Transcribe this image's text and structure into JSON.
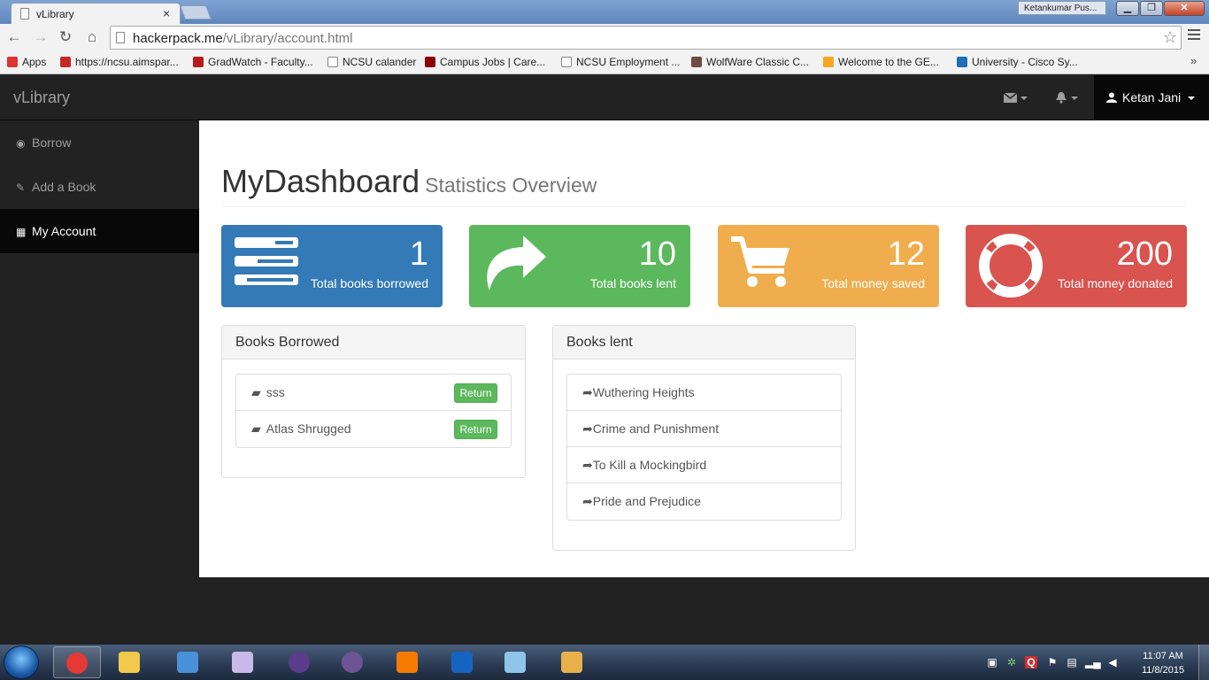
{
  "browser": {
    "tab_title": "vLibrary",
    "tab_close": "×",
    "profile_name": "Ketankumar Pus...",
    "window_buttons": {
      "minimize": "▁",
      "maximize": "❐",
      "close": "✕"
    },
    "url_host": "hackerpack.me",
    "url_path": "/vLibrary/account.html",
    "bookmarks": [
      {
        "label": "Apps",
        "color": "#d33"
      },
      {
        "label": "https://ncsu.aimspar...",
        "color": "#c62828"
      },
      {
        "label": "GradWatch - Faculty...",
        "color": "#b71c1c"
      },
      {
        "label": "NCSU calander",
        "color": "#ffffff"
      },
      {
        "label": "Campus Jobs | Care...",
        "color": "#8b0000"
      },
      {
        "label": "NCSU Employment ...",
        "color": "#ffffff"
      },
      {
        "label": "WolfWare Classic C...",
        "color": "#6d4c41"
      },
      {
        "label": "Welcome to the GE...",
        "color": "#f5a623"
      },
      {
        "label": "University - Cisco Sy...",
        "color": "#1e6fb5"
      }
    ],
    "bookmarks_more": "»"
  },
  "app": {
    "brand": "vLibrary",
    "user_name": "Ketan Jani",
    "sidebar": [
      {
        "label": "Borrow",
        "icon": "dashboard-icon",
        "glyph": "◉"
      },
      {
        "label": "Add a Book",
        "icon": "edit-icon",
        "glyph": "✎"
      },
      {
        "label": "My Account",
        "icon": "table-icon",
        "glyph": "▦"
      }
    ],
    "page_title": "MyDashboard",
    "page_subtitle": "Statistics Overview",
    "stats": [
      {
        "value": "1",
        "label": "Total books borrowed",
        "color": "#337ab7",
        "icon": "list-icon"
      },
      {
        "value": "10",
        "label": "Total books lent",
        "color": "#5cb85c",
        "icon": "share-arrow-icon"
      },
      {
        "value": "12",
        "label": "Total money saved",
        "color": "#f0ad4e",
        "icon": "cart-icon"
      },
      {
        "value": "200",
        "label": "Total money donated",
        "color": "#d9534f",
        "icon": "life-ring-icon"
      }
    ],
    "borrowed_panel": {
      "title": "Books Borrowed",
      "books": [
        "sss",
        "Atlas Shrugged"
      ],
      "return_label": "Return"
    },
    "lent_panel": {
      "title": "Books lent",
      "books": [
        "Wuthering Heights",
        "Crime and Punishment",
        "To Kill a Mockingbird",
        "Pride and Prejudice"
      ]
    }
  },
  "taskbar": {
    "time": "11:07 AM",
    "date": "11/8/2015",
    "apps": [
      {
        "name": "chrome",
        "color": "#e53935"
      },
      {
        "name": "explorer",
        "color": "#f2c94c"
      },
      {
        "name": "remote-desktop",
        "color": "#4a90d9"
      },
      {
        "name": "snipping-tool",
        "color": "#c9b8e8"
      },
      {
        "name": "eclipse",
        "color": "#5b3b8c"
      },
      {
        "name": "github",
        "color": "#6e5494"
      },
      {
        "name": "sublime",
        "color": "#f57c00"
      },
      {
        "name": "powershell",
        "color": "#1565c0"
      },
      {
        "name": "notepad",
        "color": "#8ec5e8"
      },
      {
        "name": "paint",
        "color": "#e8b04a"
      }
    ]
  }
}
